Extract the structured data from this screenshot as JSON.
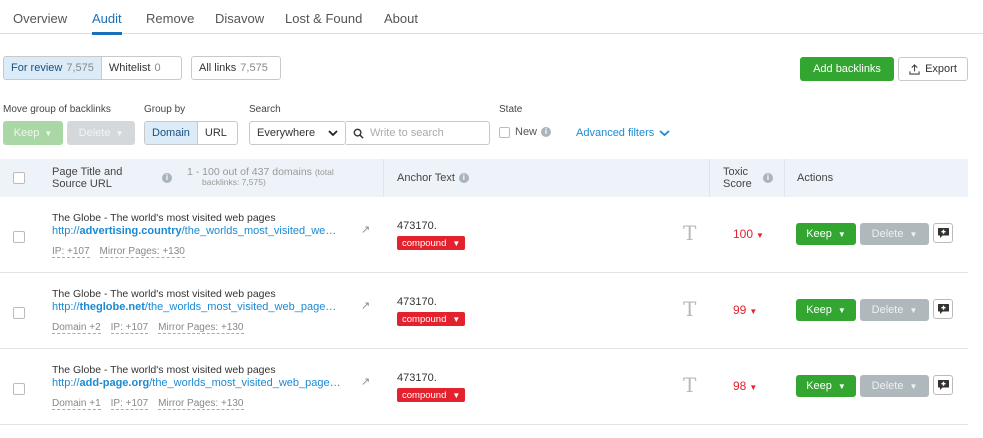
{
  "tabs": [
    {
      "label": "Overview"
    },
    {
      "label": "Audit"
    },
    {
      "label": "Remove"
    },
    {
      "label": "Disavow"
    },
    {
      "label": "Lost & Found"
    },
    {
      "label": "About"
    }
  ],
  "filters": {
    "for_review_label": "For review",
    "for_review_count": "7,575",
    "whitelist_label": "Whitelist",
    "whitelist_count": "0",
    "all_links_label": "All links",
    "all_links_count": "7,575"
  },
  "toolbar": {
    "add_backlinks": "Add backlinks",
    "export": "Export"
  },
  "controls": {
    "move_group_label": "Move group of backlinks",
    "keep": "Keep",
    "delete": "Delete",
    "group_by_label": "Group by",
    "domain": "Domain",
    "url": "URL",
    "search_label": "Search",
    "search_scope": "Everywhere",
    "search_placeholder": "Write to search",
    "state_label": "State",
    "state_new": "New",
    "advanced_filters": "Advanced filters"
  },
  "table": {
    "col_title_line1": "Page Title and",
    "col_title_line2": "Source URL",
    "range_text": "1 - 100 out of 437 domains",
    "total_prefix": "(total",
    "total_text": "backlinks: 7,575)",
    "col_anchor": "Anchor Text",
    "col_toxic_line1": "Toxic",
    "col_toxic_line2": "Score",
    "col_actions": "Actions",
    "rows": [
      {
        "title": "The Globe - The world's most visited web pages",
        "url_prefix": "http://",
        "url_domain": "advertising.country",
        "url_path": "/the_worlds_most_visited_we…",
        "meta1": "IP: +107",
        "meta2": "Mirror Pages: +130",
        "meta3": "",
        "anchor": "473170.",
        "tag": "compound",
        "score": "100",
        "keep": "Keep",
        "delete": "Delete"
      },
      {
        "title": "The Globe - The world's most visited web pages",
        "url_prefix": "http://",
        "url_domain": "theglobe.net",
        "url_path": "/the_worlds_most_visited_web_page…",
        "meta1": "Domain +2",
        "meta2": "IP: +107",
        "meta3": "Mirror Pages: +130",
        "anchor": "473170.",
        "tag": "compound",
        "score": "99",
        "keep": "Keep",
        "delete": "Delete"
      },
      {
        "title": "The Globe - The world's most visited web pages",
        "url_prefix": "http://",
        "url_domain": "add-page.org",
        "url_path": "/the_worlds_most_visited_web_page…",
        "meta1": "Domain +1",
        "meta2": "IP: +107",
        "meta3": "Mirror Pages: +130",
        "anchor": "473170.",
        "tag": "compound",
        "score": "98",
        "keep": "Keep",
        "delete": "Delete"
      }
    ]
  },
  "colors": {
    "accent": "#1a6fb8",
    "green": "#33a531",
    "red": "#e4222e"
  },
  "icons": {
    "external": "external-link-icon",
    "type": "text-type-icon",
    "comment": "comment-icon",
    "export": "export-icon",
    "search": "search-icon"
  }
}
